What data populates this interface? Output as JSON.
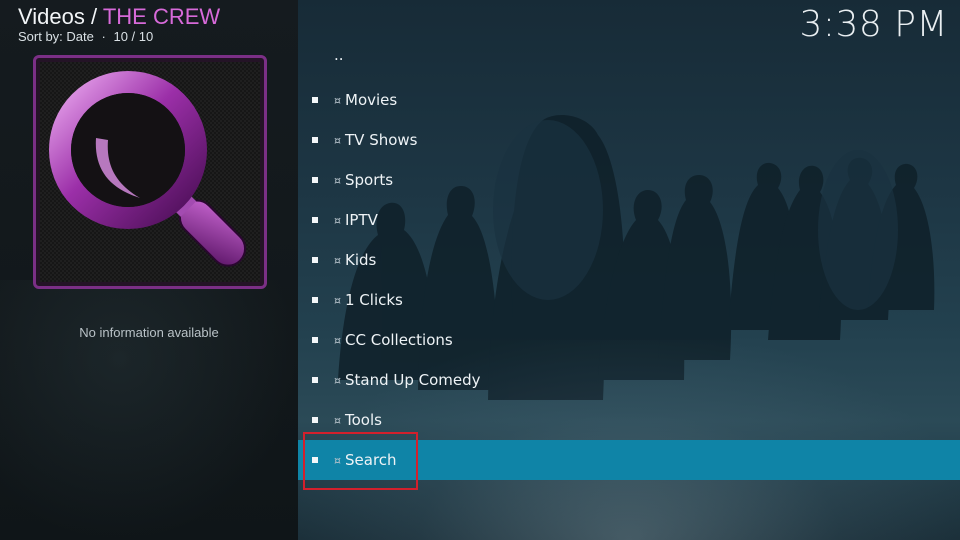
{
  "header": {
    "section": "Videos",
    "separator": "/",
    "addon_name": "THE CREW",
    "sort_label": "Sort by: Date",
    "bullet": "·",
    "position": "10 / 10",
    "clock": "3:38 PM"
  },
  "info_panel": {
    "thumbnail_icon": "magnifier-icon",
    "no_info": "No information available",
    "accent_color": "#7b2f86"
  },
  "list": {
    "parent": "..",
    "item_glyph": "¤",
    "items": [
      {
        "label": "Movies"
      },
      {
        "label": "TV Shows"
      },
      {
        "label": "Sports"
      },
      {
        "label": "IPTV"
      },
      {
        "label": "Kids"
      },
      {
        "label": "1 Clicks"
      },
      {
        "label": "CC Collections"
      },
      {
        "label": "Stand Up Comedy"
      },
      {
        "label": "Tools"
      },
      {
        "label": "Search"
      }
    ],
    "focused_index": 9,
    "focus_color": "#0f84a7",
    "annotation_color": "#d3202c"
  }
}
